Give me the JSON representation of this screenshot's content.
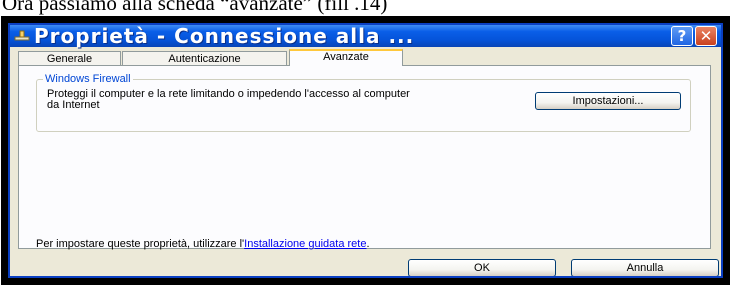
{
  "caption": "Ora passiamo alla scheda “avanzate” (fill .14)",
  "window": {
    "title": "Proprietà - Connessione alla ...",
    "help_label": "?",
    "close_label": "✕",
    "title_color": "#0a5ee8"
  },
  "tabs": [
    {
      "label": "Generale",
      "active": false
    },
    {
      "label": "Autenticazione",
      "active": false
    },
    {
      "label": "Avanzate",
      "active": true
    }
  ],
  "firewall": {
    "group_title": "Windows Firewall",
    "description": "Proteggi il computer e la rete limitando o impedendo l'accesso al computer da Internet",
    "settings_label": "Impostazioni..."
  },
  "footer": {
    "text": "Per impostare queste proprietà, utilizzare l'",
    "link": "Installazione guidata rete",
    "period": "."
  },
  "buttons": {
    "ok_label": "OK",
    "cancel_label": "Annulla"
  }
}
